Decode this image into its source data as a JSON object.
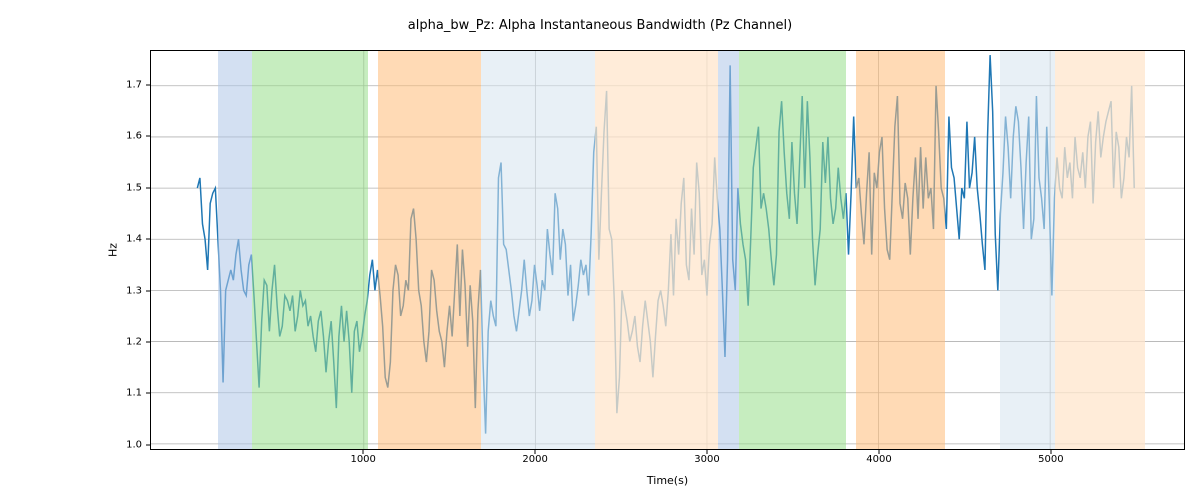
{
  "chart_data": {
    "type": "line",
    "title": "alpha_bw_Pz: Alpha Instantaneous Bandwidth (Pz Channel)",
    "xlabel": "Time(s)",
    "ylabel": "Hz",
    "xlim": [
      -240,
      5780
    ],
    "ylim": [
      0.99,
      1.768
    ],
    "x_ticks": [
      1000,
      2000,
      3000,
      4000,
      5000
    ],
    "y_ticks": [
      1.0,
      1.1,
      1.2,
      1.3,
      1.4,
      1.5,
      1.6,
      1.7
    ],
    "bands": [
      {
        "start": 150,
        "end": 350,
        "color": "#aec7e8",
        "alpha": 0.55
      },
      {
        "start": 350,
        "end": 1020,
        "color": "#98df8a",
        "alpha": 0.55
      },
      {
        "start": 1080,
        "end": 1680,
        "color": "#ffbb78",
        "alpha": 0.55
      },
      {
        "start": 1680,
        "end": 2340,
        "color": "#d6e4ef",
        "alpha": 0.55
      },
      {
        "start": 2340,
        "end": 3060,
        "color": "#ffe6cc",
        "alpha": 0.75
      },
      {
        "start": 3060,
        "end": 3180,
        "color": "#aec7e8",
        "alpha": 0.55
      },
      {
        "start": 3180,
        "end": 3800,
        "color": "#98df8a",
        "alpha": 0.55
      },
      {
        "start": 3860,
        "end": 4380,
        "color": "#ffbb78",
        "alpha": 0.55
      },
      {
        "start": 4380,
        "end": 4700,
        "color": "#ffffff",
        "alpha": 0.0
      },
      {
        "start": 4700,
        "end": 5020,
        "color": "#d6e4ef",
        "alpha": 0.55
      },
      {
        "start": 5020,
        "end": 5540,
        "color": "#ffe6cc",
        "alpha": 0.75
      }
    ],
    "series": [
      {
        "name": "alpha_bw_Pz",
        "color": "#1f77b4",
        "x": [
          30,
          45,
          60,
          75,
          90,
          105,
          120,
          135,
          150,
          165,
          180,
          195,
          210,
          225,
          240,
          255,
          270,
          285,
          300,
          315,
          330,
          345,
          360,
          375,
          390,
          405,
          420,
          435,
          450,
          465,
          480,
          495,
          510,
          525,
          540,
          555,
          570,
          585,
          600,
          615,
          630,
          645,
          660,
          675,
          690,
          705,
          720,
          735,
          750,
          765,
          780,
          795,
          810,
          825,
          840,
          855,
          870,
          885,
          900,
          915,
          930,
          945,
          960,
          975,
          990,
          1005,
          1020,
          1035,
          1050,
          1065,
          1080,
          1095,
          1110,
          1125,
          1140,
          1155,
          1170,
          1185,
          1200,
          1215,
          1230,
          1245,
          1260,
          1275,
          1290,
          1305,
          1320,
          1335,
          1350,
          1365,
          1380,
          1395,
          1410,
          1425,
          1440,
          1455,
          1470,
          1485,
          1500,
          1515,
          1530,
          1545,
          1560,
          1575,
          1590,
          1605,
          1620,
          1635,
          1650,
          1665,
          1680,
          1695,
          1710,
          1725,
          1740,
          1755,
          1770,
          1785,
          1800,
          1815,
          1830,
          1845,
          1860,
          1875,
          1890,
          1905,
          1920,
          1935,
          1950,
          1965,
          1980,
          1995,
          2010,
          2025,
          2040,
          2055,
          2070,
          2085,
          2100,
          2115,
          2130,
          2145,
          2160,
          2175,
          2190,
          2205,
          2220,
          2235,
          2250,
          2265,
          2280,
          2295,
          2310,
          2325,
          2340,
          2355,
          2370,
          2385,
          2400,
          2415,
          2430,
          2445,
          2460,
          2475,
          2490,
          2505,
          2520,
          2535,
          2550,
          2565,
          2580,
          2595,
          2610,
          2625,
          2640,
          2655,
          2670,
          2685,
          2700,
          2715,
          2730,
          2745,
          2760,
          2775,
          2790,
          2805,
          2820,
          2835,
          2850,
          2865,
          2880,
          2895,
          2910,
          2925,
          2940,
          2955,
          2970,
          2985,
          3000,
          3015,
          3030,
          3045,
          3060,
          3075,
          3090,
          3105,
          3120,
          3135,
          3150,
          3165,
          3180,
          3195,
          3210,
          3225,
          3240,
          3255,
          3270,
          3285,
          3300,
          3315,
          3330,
          3345,
          3360,
          3375,
          3390,
          3405,
          3420,
          3435,
          3450,
          3465,
          3480,
          3495,
          3510,
          3525,
          3540,
          3555,
          3570,
          3585,
          3600,
          3615,
          3630,
          3645,
          3660,
          3675,
          3690,
          3705,
          3720,
          3735,
          3750,
          3765,
          3780,
          3795,
          3810,
          3825,
          3840,
          3855,
          3870,
          3885,
          3900,
          3915,
          3930,
          3945,
          3960,
          3975,
          3990,
          4005,
          4020,
          4035,
          4050,
          4065,
          4080,
          4095,
          4110,
          4125,
          4140,
          4155,
          4170,
          4185,
          4200,
          4215,
          4230,
          4245,
          4260,
          4275,
          4290,
          4305,
          4320,
          4335,
          4350,
          4365,
          4380,
          4395,
          4410,
          4425,
          4440,
          4455,
          4470,
          4485,
          4500,
          4515,
          4530,
          4545,
          4560,
          4575,
          4590,
          4605,
          4620,
          4635,
          4650,
          4665,
          4680,
          4695,
          4710,
          4725,
          4740,
          4755,
          4770,
          4785,
          4800,
          4815,
          4830,
          4845,
          4860,
          4875,
          4890,
          4905,
          4920,
          4935,
          4950,
          4965,
          4980,
          4995,
          5010,
          5025,
          5040,
          5055,
          5070,
          5085,
          5100,
          5115,
          5130,
          5145,
          5160,
          5175,
          5190,
          5205,
          5220,
          5235,
          5250,
          5265,
          5280,
          5295,
          5310,
          5325,
          5340,
          5355,
          5370,
          5385,
          5400,
          5415,
          5430,
          5445,
          5460,
          5475,
          5490,
          5505,
          5520
        ],
        "y": [
          1.5,
          1.52,
          1.43,
          1.4,
          1.34,
          1.47,
          1.49,
          1.5,
          1.4,
          1.3,
          1.12,
          1.3,
          1.32,
          1.34,
          1.32,
          1.37,
          1.4,
          1.34,
          1.3,
          1.29,
          1.35,
          1.37,
          1.29,
          1.2,
          1.11,
          1.24,
          1.32,
          1.31,
          1.22,
          1.3,
          1.35,
          1.27,
          1.21,
          1.23,
          1.29,
          1.28,
          1.26,
          1.29,
          1.22,
          1.25,
          1.3,
          1.27,
          1.28,
          1.23,
          1.25,
          1.21,
          1.18,
          1.24,
          1.26,
          1.21,
          1.14,
          1.2,
          1.24,
          1.16,
          1.07,
          1.21,
          1.27,
          1.2,
          1.26,
          1.2,
          1.1,
          1.22,
          1.24,
          1.18,
          1.21,
          1.25,
          1.28,
          1.33,
          1.36,
          1.3,
          1.34,
          1.29,
          1.23,
          1.13,
          1.11,
          1.16,
          1.3,
          1.35,
          1.33,
          1.25,
          1.27,
          1.32,
          1.3,
          1.44,
          1.46,
          1.4,
          1.3,
          1.27,
          1.2,
          1.16,
          1.22,
          1.34,
          1.32,
          1.26,
          1.22,
          1.2,
          1.15,
          1.22,
          1.27,
          1.21,
          1.3,
          1.39,
          1.25,
          1.38,
          1.31,
          1.19,
          1.31,
          1.24,
          1.07,
          1.26,
          1.34,
          1.16,
          1.02,
          1.22,
          1.28,
          1.25,
          1.23,
          1.52,
          1.55,
          1.39,
          1.38,
          1.34,
          1.3,
          1.25,
          1.22,
          1.26,
          1.3,
          1.36,
          1.3,
          1.25,
          1.28,
          1.35,
          1.31,
          1.26,
          1.32,
          1.3,
          1.42,
          1.37,
          1.33,
          1.49,
          1.46,
          1.36,
          1.42,
          1.39,
          1.29,
          1.35,
          1.24,
          1.27,
          1.31,
          1.36,
          1.33,
          1.35,
          1.29,
          1.41,
          1.57,
          1.62,
          1.36,
          1.49,
          1.61,
          1.69,
          1.42,
          1.4,
          1.28,
          1.06,
          1.13,
          1.3,
          1.27,
          1.24,
          1.2,
          1.22,
          1.25,
          1.19,
          1.16,
          1.23,
          1.28,
          1.24,
          1.2,
          1.13,
          1.21,
          1.28,
          1.3,
          1.27,
          1.23,
          1.3,
          1.41,
          1.29,
          1.44,
          1.37,
          1.47,
          1.52,
          1.35,
          1.32,
          1.46,
          1.37,
          1.55,
          1.49,
          1.33,
          1.36,
          1.29,
          1.39,
          1.43,
          1.56,
          1.48,
          1.42,
          1.3,
          1.17,
          1.36,
          1.74,
          1.36,
          1.3,
          1.5,
          1.43,
          1.39,
          1.36,
          1.27,
          1.4,
          1.54,
          1.58,
          1.62,
          1.46,
          1.49,
          1.46,
          1.42,
          1.36,
          1.31,
          1.37,
          1.61,
          1.67,
          1.57,
          1.49,
          1.44,
          1.59,
          1.49,
          1.43,
          1.55,
          1.68,
          1.5,
          1.67,
          1.56,
          1.4,
          1.31,
          1.37,
          1.42,
          1.59,
          1.51,
          1.6,
          1.48,
          1.43,
          1.46,
          1.54,
          1.48,
          1.44,
          1.49,
          1.37,
          1.49,
          1.64,
          1.5,
          1.52,
          1.45,
          1.39,
          1.49,
          1.57,
          1.37,
          1.53,
          1.5,
          1.57,
          1.6,
          1.46,
          1.38,
          1.36,
          1.49,
          1.62,
          1.68,
          1.47,
          1.44,
          1.51,
          1.48,
          1.37,
          1.48,
          1.56,
          1.44,
          1.58,
          1.46,
          1.56,
          1.48,
          1.5,
          1.42,
          1.7,
          1.61,
          1.5,
          1.48,
          1.42,
          1.64,
          1.54,
          1.52,
          1.46,
          1.4,
          1.5,
          1.48,
          1.63,
          1.5,
          1.53,
          1.6,
          1.5,
          1.45,
          1.39,
          1.34,
          1.6,
          1.76,
          1.65,
          1.41,
          1.3,
          1.45,
          1.53,
          1.64,
          1.58,
          1.48,
          1.6,
          1.66,
          1.63,
          1.54,
          1.42,
          1.55,
          1.64,
          1.4,
          1.44,
          1.68,
          1.52,
          1.48,
          1.42,
          1.62,
          1.47,
          1.29,
          1.48,
          1.56,
          1.5,
          1.48,
          1.58,
          1.52,
          1.55,
          1.48,
          1.6,
          1.54,
          1.52,
          1.57,
          1.5,
          1.6,
          1.63,
          1.47,
          1.59,
          1.65,
          1.56,
          1.6,
          1.63,
          1.65,
          1.67,
          1.5,
          1.61,
          1.58,
          1.48,
          1.52,
          1.6,
          1.56,
          1.7,
          1.5
        ]
      }
    ]
  }
}
